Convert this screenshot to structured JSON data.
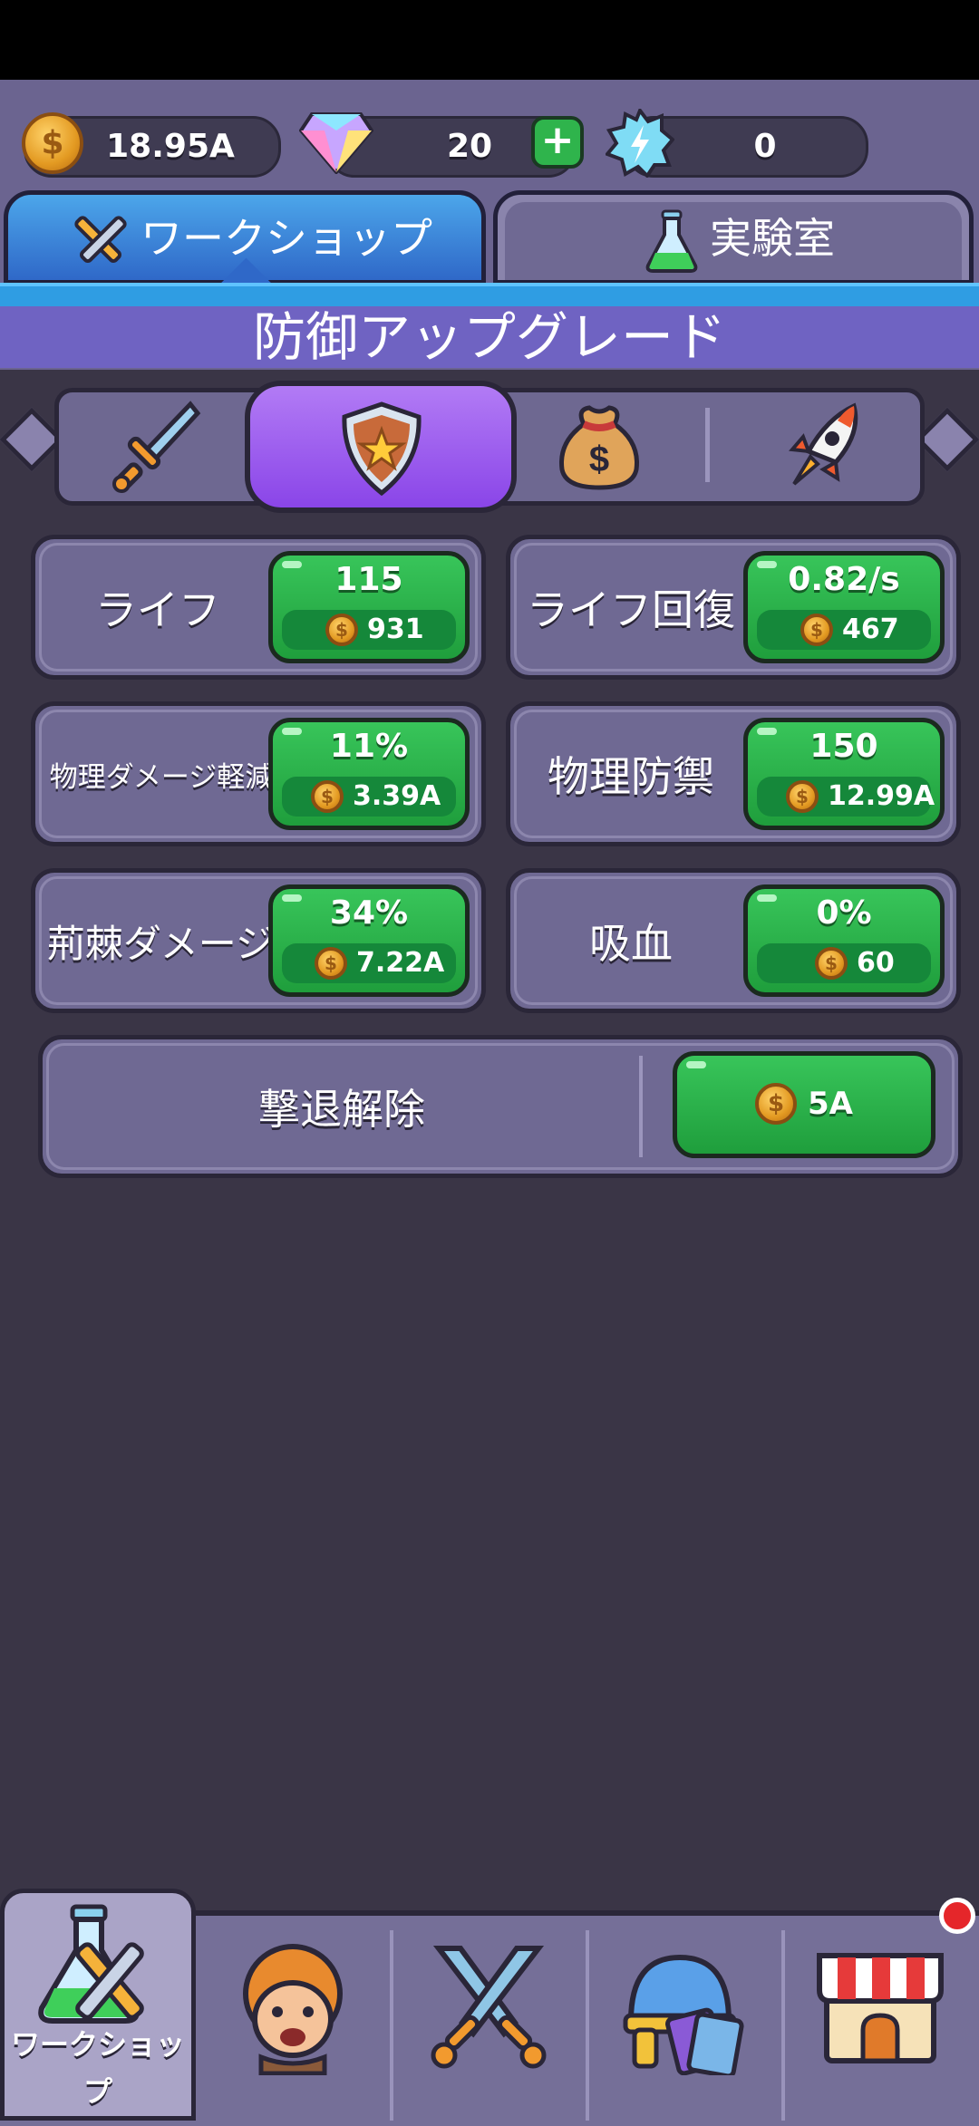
{
  "currencies": {
    "coins": "18.95A",
    "gems": "20",
    "energy": "0",
    "gems_add": "+"
  },
  "tabs": {
    "workshop": "ワークショップ",
    "lab": "実験室"
  },
  "section_title": "防御アップグレード",
  "categories": [
    "sword-icon",
    "shield-icon",
    "money-bag-icon",
    "rocket-icon"
  ],
  "upgrades": [
    {
      "label": "ライフ",
      "value": "115",
      "cost": "931"
    },
    {
      "label": "ライフ回復",
      "value": "0.82/s",
      "cost": "467"
    },
    {
      "label": "物理ダメージ軽減",
      "value": "11%",
      "cost": "3.39A"
    },
    {
      "label": "物理防禦",
      "value": "150",
      "cost": "12.99A"
    },
    {
      "label": "荊棘ダメージ",
      "value": "34%",
      "cost": "7.22A"
    },
    {
      "label": "吸血",
      "value": "0%",
      "cost": "60"
    }
  ],
  "unlock": {
    "label": "撃退解除",
    "cost": "5A"
  },
  "bottom_nav": {
    "workshop_label": "ワークショップ"
  },
  "colors": {
    "accent_green": "#2fb44c",
    "active_purple": "#9a55ee",
    "tab_blue": "#2f8fe0"
  }
}
